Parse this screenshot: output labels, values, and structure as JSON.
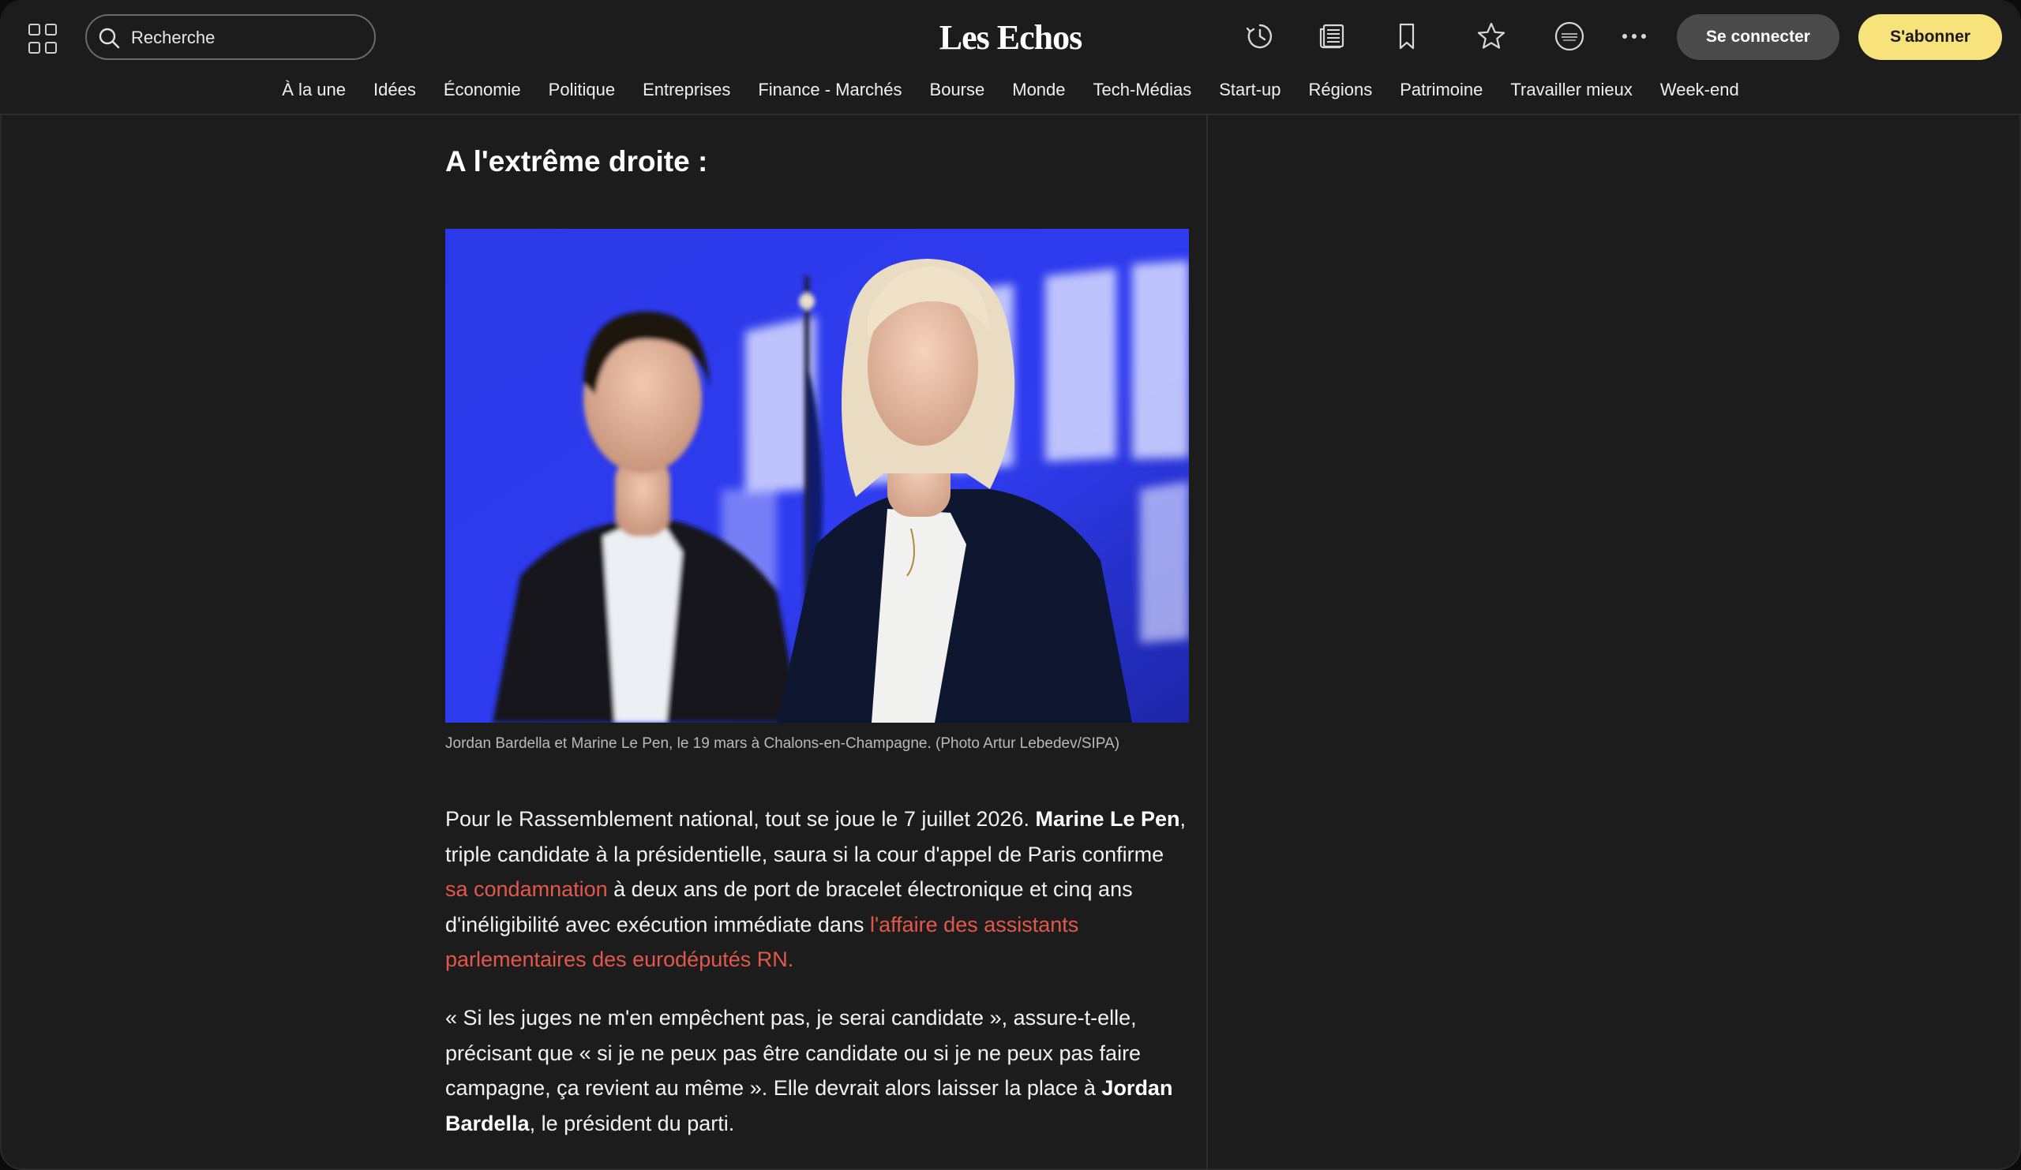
{
  "header": {
    "search_placeholder": "Recherche",
    "logo": "Les Echos",
    "login_label": "Se connecter",
    "subscribe_label": "S'abonner",
    "icons": [
      "apps-grid-icon",
      "search-icon",
      "history-icon",
      "newspaper-icon",
      "bookmark-icon",
      "star-icon",
      "les-echos-expert-icon",
      "more-icon"
    ]
  },
  "nav": {
    "items": [
      "À la une",
      "Idées",
      "Économie",
      "Politique",
      "Entreprises",
      "Finance - Marchés",
      "Bourse",
      "Monde",
      "Tech-Médias",
      "Start-up",
      "Régions",
      "Patrimoine",
      "Travailler mieux",
      "Week-end"
    ]
  },
  "article": {
    "section_title": "A l'extrême droite :",
    "photo_caption": "Jordan Bardella et Marine Le Pen, le 19 mars à Chalons-en-Champagne. (Photo Artur Lebedev/SIPA)",
    "p1": {
      "t1": "Pour le Rassemblement national, tout se joue le 7 juillet 2026. ",
      "b1": "Marine Le Pen",
      "t2": ", triple candidate à la présidentielle, saura si la cour d'appel de Paris confirme ",
      "link1": "sa condamnation",
      "t3": " à deux ans de port de bracelet électronique et cinq ans d'inéligibilité avec exécution immédiate dans ",
      "link2": "l'affaire des assistants parlementaires des eurodéputés RN."
    },
    "p2": {
      "t1": "« Si les juges ne m'en empêchent pas, je serai candidate », assure-t-elle, précisant que « si je ne peux pas être candidate ou si je ne peux pas faire campagne, ça revient au même ». Elle devrait alors laisser la place à ",
      "b1": "Jordan Bardella",
      "t2": ", le président du parti."
    }
  },
  "colors": {
    "background": "#1c1c1c",
    "subscribe_button": "#f7e27c",
    "link": "#e4574b",
    "photo_backdrop": "#2f3cf0"
  }
}
